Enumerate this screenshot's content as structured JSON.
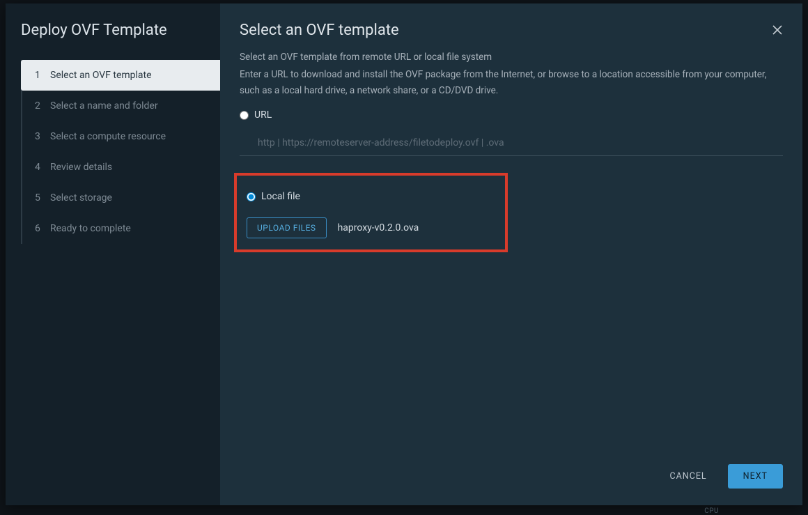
{
  "sidebar": {
    "title": "Deploy OVF Template",
    "steps": [
      {
        "num": "1",
        "label": "Select an OVF template",
        "active": true
      },
      {
        "num": "2",
        "label": "Select a name and folder",
        "active": false
      },
      {
        "num": "3",
        "label": "Select a compute resource",
        "active": false
      },
      {
        "num": "4",
        "label": "Review details",
        "active": false
      },
      {
        "num": "5",
        "label": "Select storage",
        "active": false
      },
      {
        "num": "6",
        "label": "Ready to complete",
        "active": false
      }
    ]
  },
  "main": {
    "title": "Select an OVF template",
    "subtitle": "Select an OVF template from remote URL or local file system",
    "description": "Enter a URL to download and install the OVF package from the Internet, or browse to a location accessible from your computer, such as a local hard drive, a network share, or a CD/DVD drive.",
    "url_option_label": "URL",
    "url_placeholder": "http | https://remoteserver-address/filetodeploy.ovf | .ova",
    "local_option_label": "Local file",
    "upload_button_label": "UPLOAD FILES",
    "filename": "haproxy-v0.2.0.ova"
  },
  "footer": {
    "cancel_label": "CANCEL",
    "next_label": "NEXT"
  },
  "bg": {
    "cpu_label": "CPU"
  }
}
